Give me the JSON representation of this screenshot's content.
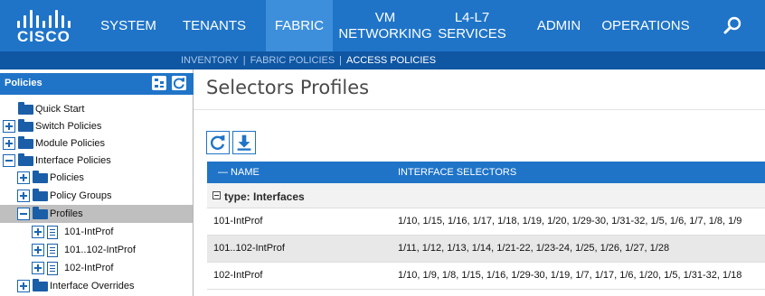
{
  "brand": {
    "logo_text": "CISCO"
  },
  "nav": {
    "items": [
      {
        "label": "SYSTEM"
      },
      {
        "label": "TENANTS"
      },
      {
        "label": "FABRIC"
      },
      {
        "line1": "VM",
        "line2": "NETWORKING"
      },
      {
        "line1": "L4-L7",
        "line2": "SERVICES"
      },
      {
        "label": "ADMIN"
      },
      {
        "label": "OPERATIONS"
      }
    ],
    "active": "FABRIC",
    "search_icon": "search-icon"
  },
  "subnav": {
    "items": [
      {
        "label": "INVENTORY"
      },
      {
        "label": "FABRIC POLICIES"
      },
      {
        "label": "ACCESS POLICIES"
      }
    ],
    "separator": "|",
    "current": "ACCESS POLICIES"
  },
  "left_panel": {
    "title": "Policies",
    "header_icons": [
      "tree-view-icon",
      "refresh-icon"
    ],
    "tree": [
      {
        "label": "Quick Start",
        "expander": "none",
        "icon": "folder-icon"
      },
      {
        "label": "Switch Policies",
        "expander": "plus",
        "icon": "folder-icon"
      },
      {
        "label": "Module Policies",
        "expander": "plus",
        "icon": "folder-icon"
      },
      {
        "label": "Interface Policies",
        "expander": "minus",
        "icon": "folder-icon"
      },
      {
        "label": "Policies",
        "expander": "plus",
        "icon": "folder-icon"
      },
      {
        "label": "Policy Groups",
        "expander": "plus",
        "icon": "folder-icon"
      },
      {
        "label": "Profiles",
        "expander": "minus",
        "icon": "folder-icon",
        "selected": true
      },
      {
        "label": "101-IntProf",
        "expander": "plus",
        "icon": "document-icon"
      },
      {
        "label": "101..102-IntProf",
        "expander": "plus",
        "icon": "document-icon"
      },
      {
        "label": "102-IntProf",
        "expander": "plus",
        "icon": "document-icon"
      },
      {
        "label": "Interface Overrides",
        "expander": "plus",
        "icon": "folder-icon"
      }
    ]
  },
  "main": {
    "title": "Selectors Profiles",
    "toolbar": {
      "refresh_icon": "refresh-icon",
      "download_icon": "download-icon"
    },
    "table": {
      "columns": [
        "— NAME",
        "INTERFACE SELECTORS"
      ],
      "group_label": "type: Interfaces",
      "rows": [
        {
          "name": "101-IntProf",
          "selectors": "1/10, 1/15, 1/16, 1/17, 1/18, 1/19, 1/20, 1/29-30, 1/31-32, 1/5, 1/6, 1/7, 1/8, 1/9"
        },
        {
          "name": "101..102-IntProf",
          "selectors": "1/11, 1/12, 1/13, 1/14, 1/21-22, 1/23-24, 1/25, 1/26, 1/27, 1/28"
        },
        {
          "name": "102-IntProf",
          "selectors": "1/10, 1/9, 1/8, 1/15, 1/16, 1/29-30, 1/19, 1/7, 1/17, 1/6, 1/20, 1/5, 1/31-32, 1/18"
        }
      ]
    }
  },
  "colors": {
    "nav_blue": "#1f74c8",
    "nav_active": "#3d8fdc",
    "subnav_blue": "#0f56a3",
    "folder_blue": "#1a5ea8",
    "selected_row": "#bfbfbf"
  }
}
